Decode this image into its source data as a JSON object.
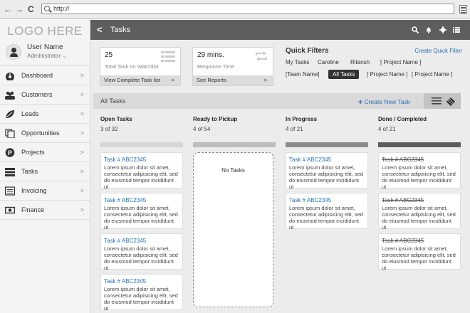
{
  "browser": {
    "url": "http://",
    "back": "←",
    "forward": "→",
    "reload": "C"
  },
  "sidebar": {
    "logo": "LOGO HERE",
    "user": {
      "name": "User Name",
      "role": "Administrator ⌵"
    },
    "items": [
      {
        "label": "Dashboard",
        "icon": "dashboard-icon"
      },
      {
        "label": "Customers",
        "icon": "users-icon"
      },
      {
        "label": "Leads",
        "icon": "leaf-icon"
      },
      {
        "label": "Opportunities",
        "icon": "copy-icon"
      },
      {
        "label": "Projects",
        "icon": "p-circle-icon"
      },
      {
        "label": "Tasks",
        "icon": "tasks-icon"
      },
      {
        "label": "Invoicing",
        "icon": "invoice-icon"
      },
      {
        "label": "Finance",
        "icon": "money-icon"
      }
    ],
    "chevron": ">"
  },
  "topbar": {
    "back": "<",
    "title": "Tasks"
  },
  "cards": [
    {
      "value": "25",
      "caption": "Total Task on Watchlist",
      "link": "View Complete Task list",
      "icon": "list-icon"
    },
    {
      "value": "29 mins.",
      "caption": "Response Time",
      "link": "See Reports",
      "icon": "refresh-icon"
    }
  ],
  "card_arrow": ">",
  "quick_filters": {
    "title": "Quick Filters",
    "create": "Create Quick Filter",
    "row1": [
      "My Tasks",
      "Caroline",
      "Ritansh",
      "[ Project Name ]"
    ],
    "row2": [
      "[Team Name]",
      "All Tasks",
      "[ Project Name ]",
      "[ Project Name ]"
    ]
  },
  "all_tasks": {
    "label": "All Tasks",
    "new_task": "Create New Task",
    "plus": "+"
  },
  "columns": [
    {
      "name": "Open Tasks",
      "count": "3 of 32",
      "bar": "#d6d6d6"
    },
    {
      "name": "Ready to Pickup",
      "count": "4 of 54",
      "bar": "#bdbdbd"
    },
    {
      "name": "In Progress",
      "count": "4 of 21",
      "bar": "#8c8c8c"
    },
    {
      "name": "Done / Completed",
      "count": "4 of 21",
      "bar": "#5e5e5e"
    }
  ],
  "task_title": "Task # ABC2345",
  "task_body": "Lorem ipsum dolor sit amet, consectetur adipisicing elit, sed do eiusmod tempor incididunt ut",
  "no_tasks": "No Tasks",
  "colors": {
    "accent": "#2a72b5",
    "topbar": "#5e5e5e"
  }
}
